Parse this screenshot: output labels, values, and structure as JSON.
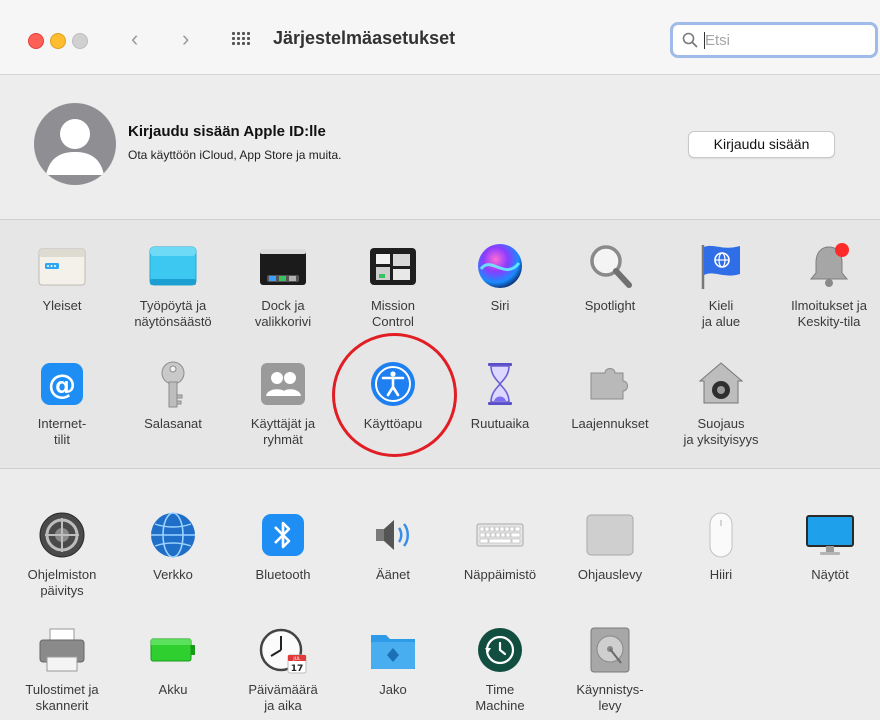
{
  "window": {
    "title": "Järjestelmäasetukset",
    "search_placeholder": "Etsi"
  },
  "apple_id": {
    "title": "Kirjaudu sisään Apple ID:lle",
    "subtitle": "Ota käyttöön iCloud, App Store ja muita.",
    "button_label": "Kirjaudu sisään"
  },
  "section1": {
    "items": [
      {
        "label": "Yleiset",
        "icon": "general-icon"
      },
      {
        "label": "Työpöytä ja\nnäytönsäästö",
        "icon": "desktop-screensaver-icon"
      },
      {
        "label": "Dock ja\nvalikkorivi",
        "icon": "dock-menubar-icon"
      },
      {
        "label": "Mission\nControl",
        "icon": "mission-control-icon"
      },
      {
        "label": "Siri",
        "icon": "siri-icon"
      },
      {
        "label": "Spotlight",
        "icon": "spotlight-icon"
      },
      {
        "label": "Kieli\nja alue",
        "icon": "language-region-icon"
      },
      {
        "label": "Ilmoitukset ja\nKeskity-tila",
        "icon": "notifications-icon"
      },
      {
        "label": "Internet-\ntilit",
        "icon": "internet-accounts-icon"
      },
      {
        "label": "Salasanat",
        "icon": "passwords-icon"
      },
      {
        "label": "Käyttäjät ja\nryhmät",
        "icon": "users-groups-icon"
      },
      {
        "label": "Käyttöapu",
        "icon": "accessibility-icon"
      },
      {
        "label": "Ruutuaika",
        "icon": "screen-time-icon"
      },
      {
        "label": "Laajennukset",
        "icon": "extensions-icon"
      },
      {
        "label": "Suojaus\nja yksityisyys",
        "icon": "security-privacy-icon"
      }
    ]
  },
  "section2": {
    "items": [
      {
        "label": "Ohjelmiston\npäivitys",
        "icon": "software-update-icon"
      },
      {
        "label": "Verkko",
        "icon": "network-icon"
      },
      {
        "label": "Bluetooth",
        "icon": "bluetooth-icon"
      },
      {
        "label": "Äänet",
        "icon": "sound-icon"
      },
      {
        "label": "Näppäimistö",
        "icon": "keyboard-icon"
      },
      {
        "label": "Ohjauslevy",
        "icon": "trackpad-icon"
      },
      {
        "label": "Hiiri",
        "icon": "mouse-icon"
      },
      {
        "label": "Näytöt",
        "icon": "displays-icon"
      },
      {
        "label": "Tulostimet ja\nskannerit",
        "icon": "printers-scanners-icon"
      },
      {
        "label": "Akku",
        "icon": "battery-icon"
      },
      {
        "label": "Päivämäärä\nja aika",
        "icon": "date-time-icon"
      },
      {
        "label": "Jako",
        "icon": "sharing-icon"
      },
      {
        "label": "Time\nMachine",
        "icon": "time-machine-icon"
      },
      {
        "label": "Käynnistys-\nlevy",
        "icon": "startup-disk-icon"
      }
    ]
  },
  "calendar_icon": {
    "month": "JUL",
    "day": "17"
  },
  "colors": {
    "accent_blue": "#1d7ff0",
    "highlight_red": "#e01e24",
    "search_focus": "#9fbbea"
  }
}
